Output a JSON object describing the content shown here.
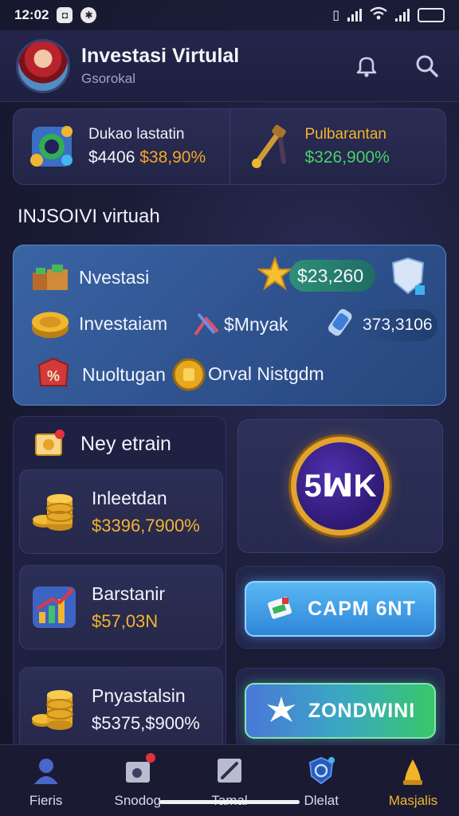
{
  "status_bar": {
    "time": "12:02"
  },
  "header": {
    "title": "Investasi Virtulal",
    "subtitle": "Gsorokal"
  },
  "stats": [
    {
      "label": "Dukao lastatin",
      "value_main": "$4406 ",
      "value_accent": "$38,90%",
      "icon": "gem-shield-icon"
    },
    {
      "label": "Pulbarantan",
      "value_main": "$326,900%",
      "value_accent": "",
      "icon": "hammer-icon"
    }
  ],
  "section_title": "INJSOIVI virtuah",
  "portfolio": {
    "rows": [
      {
        "label": "Nvestasi",
        "icon": "crate-icon"
      },
      {
        "label": "Investaiam",
        "icon": "gold-coin-icon"
      },
      {
        "label": "Nuoltugan",
        "icon": "percent-tag-icon"
      }
    ],
    "star_pill": "$23,260",
    "stock_label": "$Mnyak",
    "stock_pill": "373,3106",
    "coin_label": "Orval Nistgdm"
  },
  "left_column": {
    "title": "Ney etrain",
    "cards": [
      {
        "title": "Inleetdan",
        "value": "$3396,7900%",
        "icon": "coin-stack-icon"
      },
      {
        "title": "Barstanir",
        "value": "$57,03N",
        "icon": "bar-chart-icon"
      },
      {
        "title": "Pnyastalsin",
        "value": "$5375,$900%",
        "icon": "coin-stack-icon"
      }
    ]
  },
  "badge": {
    "text": "5ꟽK"
  },
  "buttons": {
    "primary": "CAPM 6NT",
    "secondary": "ZONDWINI"
  },
  "bottom_nav": [
    {
      "label": "Fieris",
      "icon": "person-icon"
    },
    {
      "label": "Snodog",
      "icon": "wallet-icon"
    },
    {
      "label": "Tamal",
      "icon": "pen-icon"
    },
    {
      "label": "Dlelat",
      "icon": "shield-badge-icon"
    },
    {
      "label": "Masjalis",
      "icon": "trophy-icon"
    }
  ],
  "colors": {
    "accent_gold": "#f4b52c",
    "accent_green": "#49d16a",
    "panel_blue": "#3a64a5"
  }
}
